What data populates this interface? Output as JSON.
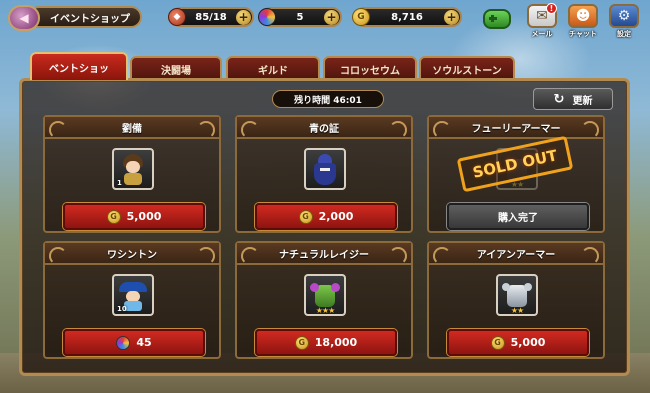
{
  "header": {
    "shop_title": "イベントショップ",
    "stamina": "85/18",
    "gems": "5",
    "gold": "8,716",
    "mail_label": "メール",
    "chat_label": "チャット",
    "settings_label": "設定",
    "mail_badge": "!"
  },
  "tabs": [
    {
      "label": "ベントショッ",
      "active": true
    },
    {
      "label": "決闘場",
      "active": false
    },
    {
      "label": "ギルド",
      "active": false
    },
    {
      "label": "コロッセウム",
      "active": false
    },
    {
      "label": "ソウルストーン",
      "active": false
    }
  ],
  "panel": {
    "timer": "残り時間 46:01",
    "refresh_label": "更新"
  },
  "items": [
    {
      "name": "劉備",
      "price": "5,000",
      "currency": "gold",
      "level": "1",
      "stars": "",
      "sold_out": false
    },
    {
      "name": "青の証",
      "price": "2,000",
      "currency": "gold",
      "level": "",
      "stars": "",
      "sold_out": false
    },
    {
      "name": "フューリーアーマー",
      "price": "購入完了",
      "currency": "none",
      "level": "",
      "stars": "★★",
      "sold_out": true,
      "stamp": "SOLD OUT"
    },
    {
      "name": "ワシントン",
      "price": "45",
      "currency": "gem",
      "level": "10",
      "stars": "",
      "sold_out": false
    },
    {
      "name": "ナチュラルレイジー",
      "price": "18,000",
      "currency": "gold",
      "level": "",
      "stars": "★★★",
      "sold_out": false
    },
    {
      "name": "アイアンアーマー",
      "price": "5,000",
      "currency": "gold",
      "level": "",
      "stars": "★★",
      "sold_out": false
    }
  ],
  "colors": {
    "buy_button": "#c3231a",
    "panel_border": "#b38a4f",
    "active_tab": "#c92b1c",
    "sold_out_stamp": "#f0a21c"
  }
}
